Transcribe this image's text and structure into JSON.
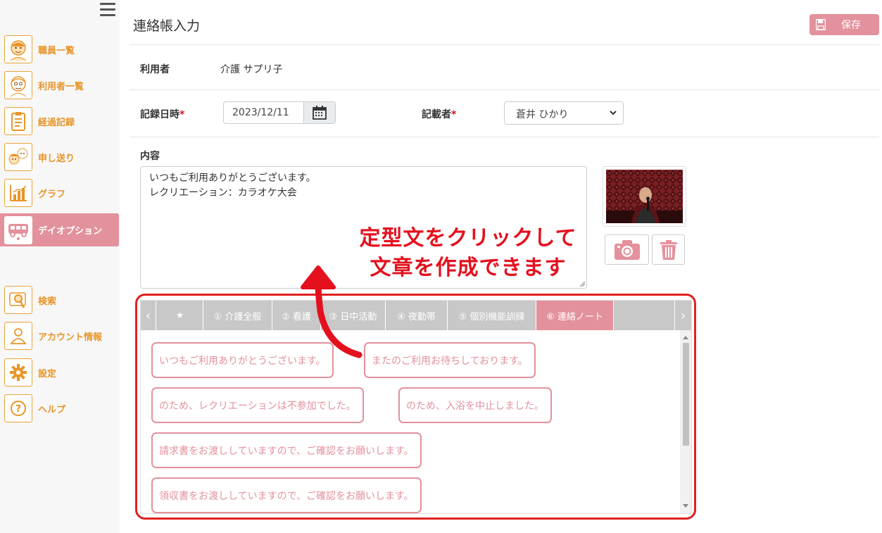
{
  "sidebar": {
    "items": [
      {
        "label": "職員一覧",
        "icon": "staff-face-icon"
      },
      {
        "label": "利用者一覧",
        "icon": "user-face-icon"
      },
      {
        "label": "経過記録",
        "icon": "clipboard-icon"
      },
      {
        "label": "申し送り",
        "icon": "handover-faces-icon"
      },
      {
        "label": "グラフ",
        "icon": "bar-chart-icon"
      },
      {
        "label": "デイオプション",
        "icon": "van-icon"
      },
      {
        "label": "検索",
        "icon": "search-icon"
      },
      {
        "label": "アカウント情報",
        "icon": "person-icon"
      },
      {
        "label": "設定",
        "icon": "gear-icon"
      },
      {
        "label": "ヘルプ",
        "icon": "question-icon"
      }
    ],
    "active": "デイオプション"
  },
  "header": {
    "title": "連絡帳入力",
    "save_label": "保存"
  },
  "form": {
    "user_label": "利用者",
    "user_value": "介護 サプリ子",
    "datetime_label": "記録日時",
    "datetime_value": "2023/12/11",
    "writer_label": "記載者",
    "writer_value": "蒼井 ひかり",
    "required_mark": "*",
    "content_label": "内容",
    "content_value": "いつもご利用ありがとうございます。\nレクリエーション：カラオケ大会"
  },
  "tabs": [
    {
      "label": "★"
    },
    {
      "label": "① 介護全般"
    },
    {
      "label": "② 看護"
    },
    {
      "label": "③ 日中活動"
    },
    {
      "label": "④ 夜勤帯"
    },
    {
      "label": "⑤ 個別機能訓練"
    },
    {
      "label": "⑥ 連絡ノート"
    }
  ],
  "active_tab": "⑥ 連絡ノート",
  "phrases": [
    "いつもご利用ありがとうございます。",
    "またのご利用お待ちしております。",
    "のため、レクリエーションは不参加でした。",
    "のため、入浴を中止しました。",
    "請求書をお渡ししていますので、ご確認をお願いします。",
    "領収書をお渡ししていますので、ご確認をお願いします。"
  ],
  "annotation": {
    "line1": "定型文をクリックして",
    "line2": "文章を作成できます"
  },
  "colors": {
    "accent_pink": "#e3919c",
    "nav_orange": "#e8952a",
    "annotation_red": "#e4101e",
    "tab_gray": "#c8c8c8"
  }
}
